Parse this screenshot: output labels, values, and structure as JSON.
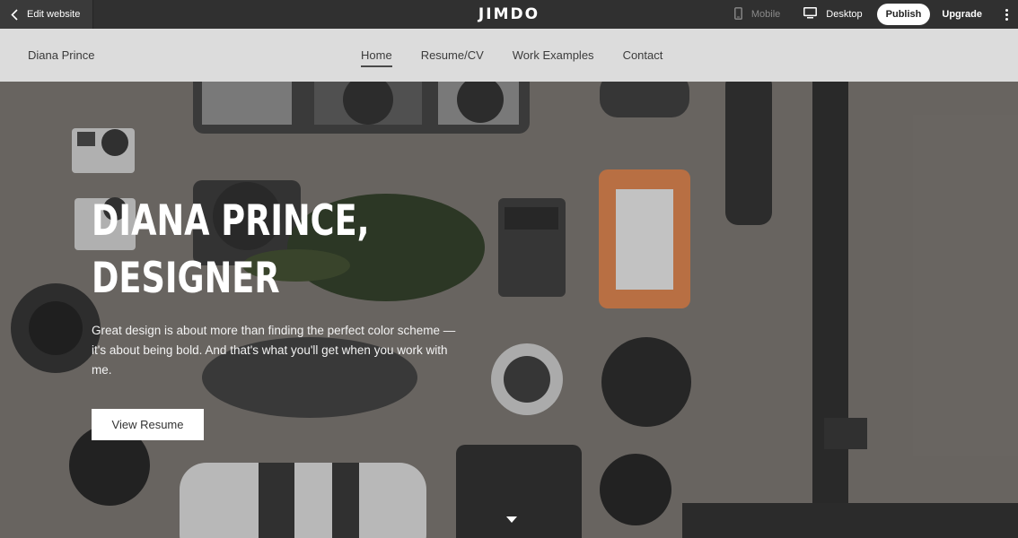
{
  "editor": {
    "back_label": "Edit website",
    "logo": "JIMDO",
    "mobile_label": "Mobile",
    "desktop_label": "Desktop",
    "publish_label": "Publish",
    "upgrade_label": "Upgrade"
  },
  "site": {
    "name": "Diana Prince",
    "menu": [
      {
        "label": "Home",
        "active": true
      },
      {
        "label": "Resume/CV"
      },
      {
        "label": "Work Examples"
      },
      {
        "label": "Contact"
      }
    ]
  },
  "hero": {
    "title_line1": "DIANA PRINCE,",
    "title_line2": "DESIGNER",
    "text": "Great design is about more than finding the perfect color scheme —it's about being bold. And that's what you'll get when you work with me.",
    "button_label": "View Resume",
    "colors": {
      "overlay": "#6f6a66",
      "button_bg": "#ffffff"
    }
  }
}
